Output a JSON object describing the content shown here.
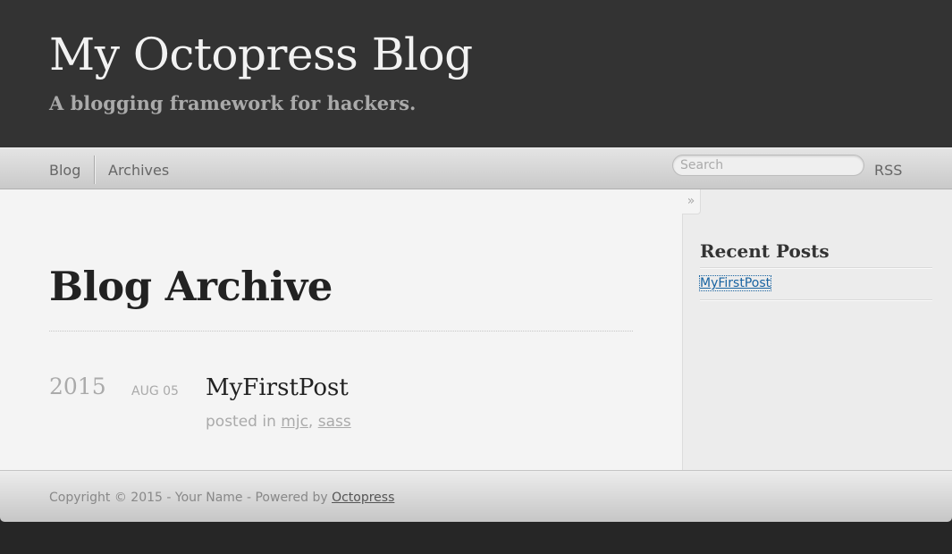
{
  "header": {
    "title": "My Octopress Blog",
    "subtitle": "A blogging framework for hackers."
  },
  "nav": {
    "items": [
      {
        "label": "Blog"
      },
      {
        "label": "Archives"
      }
    ],
    "search_placeholder": "Search",
    "rss_label": "RSS"
  },
  "main": {
    "sidebar_toggle": "»",
    "page_title": "Blog Archive",
    "archive": [
      {
        "year": "2015",
        "date": "AUG 05",
        "title": "MyFirstPost",
        "posted_in_label": "posted in",
        "categories": [
          "mjc",
          "sass"
        ],
        "category_separator": ","
      }
    ]
  },
  "sidebar": {
    "title": "Recent Posts",
    "recent_posts": [
      "MyFirstPost"
    ]
  },
  "footer": {
    "text": "Copyright © 2015 - Your Name - Powered by",
    "link": "Octopress"
  },
  "colors": {
    "header_bg": "#333333",
    "page_bg": "#262626",
    "link_blue": "#1863a1"
  }
}
